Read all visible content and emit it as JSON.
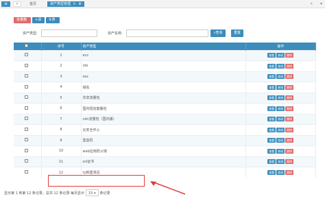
{
  "tabbar": {
    "home": "首页",
    "active_tab": "资产类型管理",
    "refresh_icon": "refresh-icon",
    "close_icon": "close-icon"
  },
  "toolbar": {
    "delete_label": "批量删除",
    "add_label": "添加",
    "sort_label": "排序"
  },
  "search": {
    "type_label": "资产类型:",
    "name_label": "资产名称:",
    "search_button": "查询",
    "reset_button": "重置"
  },
  "table": {
    "columns": [
      "序号",
      "资产类型",
      "操作"
    ],
    "rows": [
      {
        "no": "1",
        "type": "ecs"
      },
      {
        "no": "2",
        "type": "rds"
      },
      {
        "no": "3",
        "type": "oss"
      },
      {
        "no": "4",
        "type": "域名"
      },
      {
        "no": "5",
        "type": "共享流量包"
      },
      {
        "no": "6",
        "type": "国内短信套餐包"
      },
      {
        "no": "7",
        "type": "cdn流量包（国内版）"
      },
      {
        "no": "8",
        "type": "云安全中心"
      },
      {
        "no": "9",
        "type": "堡垒机"
      },
      {
        "no": "10",
        "type": "web应用防火墙"
      },
      {
        "no": "11",
        "type": "ssl证书"
      },
      {
        "no": "12",
        "type": "ty新建测试"
      }
    ],
    "actions": {
      "view": "查看",
      "edit": "修改",
      "delete": "删除"
    }
  },
  "footer": {
    "summary": "显示第 1 到第 12 条记录，总共 12 条记录 每页显示",
    "page_size": "15",
    "suffix": "条记录"
  },
  "colors": {
    "primary": "#3c8dbc",
    "danger": "#e26a6a",
    "highlight": "#e53935"
  }
}
